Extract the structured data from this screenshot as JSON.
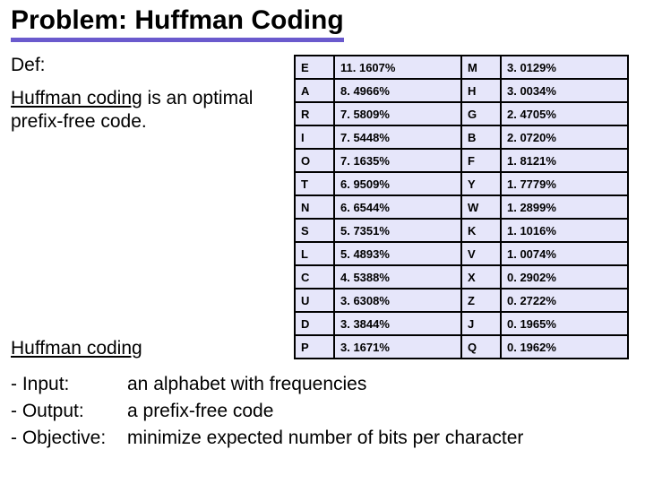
{
  "title": "Problem: Huffman Coding",
  "def_label": "Def:",
  "body_prefix": "Huffman coding",
  "body_rest": " is an optimal prefix-free code.",
  "footer_link": "Huffman coding",
  "rows": [
    {
      "l1": "E",
      "p1": "11. 1607%",
      "l2": "M",
      "p2": "3. 0129%"
    },
    {
      "l1": "A",
      "p1": "8. 4966%",
      "l2": "H",
      "p2": "3. 0034%"
    },
    {
      "l1": "R",
      "p1": "7. 5809%",
      "l2": "G",
      "p2": "2. 4705%"
    },
    {
      "l1": "I",
      "p1": "7. 5448%",
      "l2": "B",
      "p2": "2. 0720%"
    },
    {
      "l1": "O",
      "p1": "7. 1635%",
      "l2": "F",
      "p2": "1. 8121%"
    },
    {
      "l1": "T",
      "p1": "6. 9509%",
      "l2": "Y",
      "p2": "1. 7779%"
    },
    {
      "l1": "N",
      "p1": "6. 6544%",
      "l2": "W",
      "p2": "1. 2899%"
    },
    {
      "l1": "S",
      "p1": "5. 7351%",
      "l2": "K",
      "p2": "1. 1016%"
    },
    {
      "l1": "L",
      "p1": "5. 4893%",
      "l2": "V",
      "p2": "1. 0074%"
    },
    {
      "l1": "C",
      "p1": "4. 5388%",
      "l2": "X",
      "p2": "0. 2902%"
    },
    {
      "l1": "U",
      "p1": "3. 6308%",
      "l2": "Z",
      "p2": "0. 2722%"
    },
    {
      "l1": "D",
      "p1": "3. 3844%",
      "l2": "J",
      "p2": "0. 1965%"
    },
    {
      "l1": "P",
      "p1": "3. 1671%",
      "l2": "Q",
      "p2": "0. 1962%"
    }
  ],
  "input_label": "- Input:",
  "input_text": "an alphabet with frequencies",
  "output_label": "- Output:",
  "output_text": "a prefix-free code",
  "objective_label": "- Objective:",
  "objective_text": "minimize expected number of bits per character"
}
